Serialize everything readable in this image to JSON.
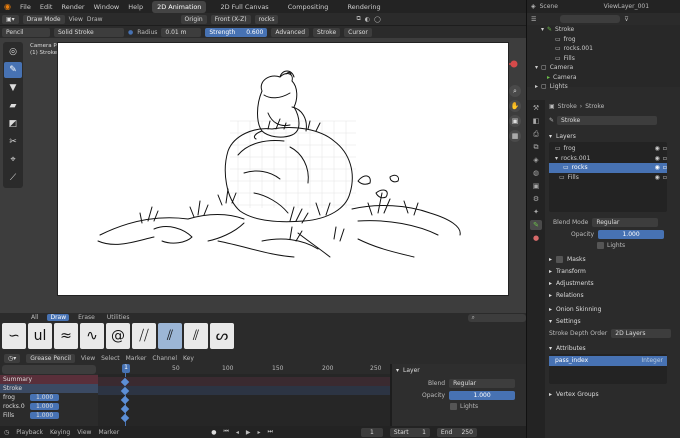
{
  "topbar": {
    "menus": [
      "File",
      "Edit",
      "Render",
      "Window",
      "Help"
    ],
    "workspaces": [
      "2D Animation",
      "2D Full Canvas",
      "Compositing",
      "Rendering"
    ],
    "active_workspace": "2D Animation",
    "scene": "Scene",
    "view_layer": "ViewLayer_001"
  },
  "header": {
    "mode": "Draw Mode",
    "menus": [
      "View",
      "Draw"
    ],
    "origin": "Origin",
    "view_axis": "Front (X-Z)",
    "layer": "rocks"
  },
  "tool_settings": {
    "tool": "Pencil",
    "material": "Solid Stroke",
    "radius_label": "Radius",
    "radius_value": "0.01 m",
    "strength_label": "Strength",
    "strength_value": "0.600",
    "advanced": "Advanced",
    "stroke": "Stroke",
    "cursor": "Cursor"
  },
  "viewport": {
    "overlay_line1": "Camera Perspective",
    "overlay_line2": "(1) Stroke | rocks"
  },
  "brush_tabs": [
    "All",
    "Draw",
    "Erase",
    "Utilities"
  ],
  "brush_active_tab": "Draw",
  "dopesheet": {
    "mode": "Grease Pencil",
    "menus": [
      "View",
      "Select",
      "Marker",
      "Channel",
      "Key"
    ],
    "frame_labels": [
      "1",
      "50",
      "100",
      "150",
      "200",
      "250"
    ],
    "current_frame_marker": "1",
    "channels": [
      {
        "name": "Summary"
      },
      {
        "name": "Stroke"
      },
      {
        "name": "frog",
        "value": "1.000"
      },
      {
        "name": "rocks.0",
        "value": "1.000"
      },
      {
        "name": "Fills",
        "value": "1.000"
      }
    ]
  },
  "layer_panel": {
    "title": "Layer",
    "blend_label": "Blend",
    "blend_value": "Regular",
    "opacity_label": "Opacity",
    "opacity_value": "1.000",
    "lights_label": "Lights"
  },
  "playback": {
    "items": [
      "Playback",
      "Keying",
      "View",
      "Marker"
    ],
    "current": "1",
    "start_label": "Start",
    "start_value": "1",
    "end_label": "End",
    "end_value": "250"
  },
  "outliner": {
    "rows": [
      {
        "name": "Stroke",
        "indent": 1
      },
      {
        "name": "frog",
        "indent": 2
      },
      {
        "name": "rocks.001",
        "indent": 2
      },
      {
        "name": "Fills",
        "indent": 2
      },
      {
        "name": "Camera",
        "indent": 0
      },
      {
        "name": "Camera",
        "indent": 1
      },
      {
        "name": "Lights",
        "indent": 0
      }
    ]
  },
  "properties": {
    "breadcrumb": [
      "Stroke",
      "Stroke"
    ],
    "object_name": "Stroke",
    "layers_title": "Layers",
    "layers": [
      "frog",
      "rocks.001",
      "rocks",
      "Fills"
    ],
    "selected_layer": "rocks",
    "blend_mode_label": "Blend Mode",
    "blend_mode_value": "Regular",
    "opacity_label": "Opacity",
    "opacity_value": "1.000",
    "lights_label": "Lights",
    "subpanels": [
      "Masks",
      "Transform",
      "Adjustments",
      "Relations"
    ],
    "onion_label": "Onion Skinning",
    "settings_label": "Settings",
    "depth_order_label": "Stroke Depth Order",
    "depth_order_value": "2D Layers",
    "attributes_label": "Attributes",
    "attribute_name": "pass_index",
    "attribute_type": "Integer",
    "vertex_groups_label": "Vertex Groups"
  },
  "colors": {
    "accent": "#4772b3",
    "panel": "#2b2b2b",
    "viewport": "#3d3d3d",
    "keyframe": "#5c8fd6"
  }
}
